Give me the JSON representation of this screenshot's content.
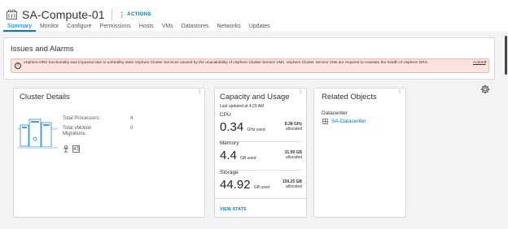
{
  "header": {
    "title": "SA-Compute-01",
    "actions_label": "ACTIONS"
  },
  "tabs": [
    {
      "label": "Summary"
    },
    {
      "label": "Monitor"
    },
    {
      "label": "Configure"
    },
    {
      "label": "Permissions"
    },
    {
      "label": "Hosts"
    },
    {
      "label": "VMs"
    },
    {
      "label": "Datastores"
    },
    {
      "label": "Networks"
    },
    {
      "label": "Updates"
    }
  ],
  "issues": {
    "title": "Issues and Alarms",
    "alert_text": "vSphere DRS functionality was impacted due to unhealthy state vSphere Cluster Services caused by the unavailability of vSphere Cluster Service VMs. vSphere Cluster Service VMs are required to maintain the health of vSphere DRS.",
    "alert_action": "Actions"
  },
  "cluster_details": {
    "title": "Cluster Details",
    "total_processors_label": "Total Processors:",
    "total_processors_value": "4",
    "total_vmotion_label": "Total vMotion Migrations:",
    "total_vmotion_value": "0"
  },
  "capacity": {
    "title": "Capacity and Usage",
    "updated": "Last updated at 4:20 AM",
    "cpu": {
      "label": "CPU",
      "used": "0.34",
      "used_unit": "GHz used",
      "allocated": "8.38 GHz",
      "allocated_label": "allocated"
    },
    "memory": {
      "label": "Memory",
      "used": "4.4",
      "used_unit": "GB used",
      "allocated": "31.99 GB",
      "allocated_label": "allocated"
    },
    "storage": {
      "label": "Storage",
      "used": "44.92",
      "used_unit": "GB used",
      "allocated": "159.25 GB",
      "allocated_label": "allocated"
    },
    "view_stats": "VIEW STATS"
  },
  "related": {
    "title": "Related Objects",
    "datacenter_label": "Datacenter",
    "datacenter_name": "SA-Datacenter"
  },
  "colors": {
    "accent": "#0079b8",
    "alert_bg": "#fbe3df"
  }
}
